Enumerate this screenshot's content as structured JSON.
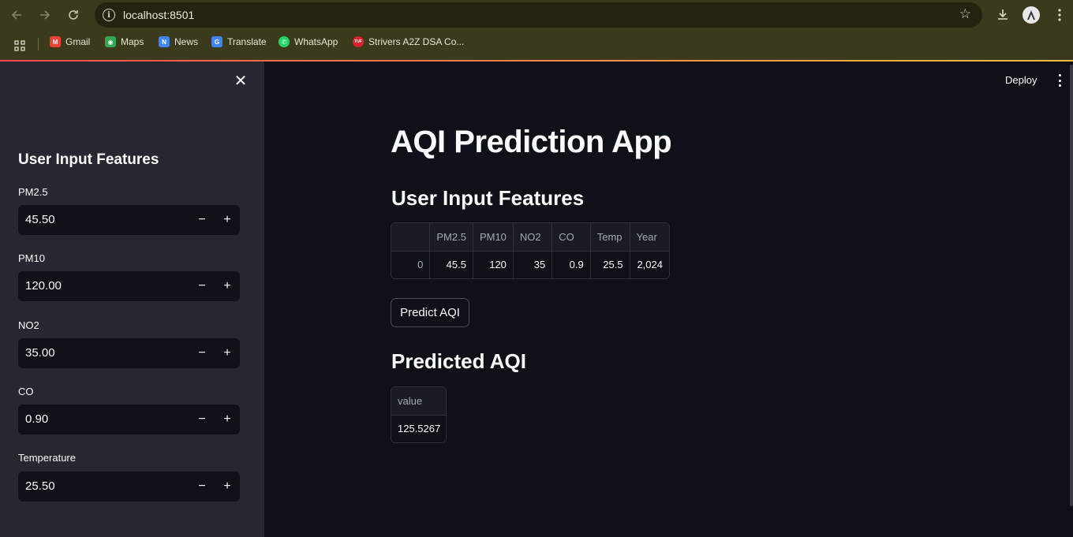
{
  "browser": {
    "url": "localhost:8501",
    "bookmarks": [
      {
        "label": "Gmail",
        "icon": "gmail-icon",
        "color": "#ea4335",
        "glyph": "M"
      },
      {
        "label": "Maps",
        "icon": "maps-icon",
        "color": "#34a853",
        "glyph": "◉"
      },
      {
        "label": "News",
        "icon": "news-icon",
        "color": "#4285f4",
        "glyph": "N"
      },
      {
        "label": "Translate",
        "icon": "translate-icon",
        "color": "#4285f4",
        "glyph": "G"
      },
      {
        "label": "WhatsApp",
        "icon": "whatsapp-icon",
        "color": "#25d366",
        "glyph": "✆"
      },
      {
        "label": "Strivers A2Z DSA Co...",
        "icon": "tuf-icon",
        "color": "#e0202c",
        "glyph": "TUF"
      }
    ]
  },
  "sidebar": {
    "title": "User Input Features",
    "fields": [
      {
        "label": "PM2.5",
        "value": "45.50"
      },
      {
        "label": "PM10",
        "value": "120.00"
      },
      {
        "label": "NO2",
        "value": "35.00"
      },
      {
        "label": "CO",
        "value": "0.90"
      },
      {
        "label": "Temperature",
        "value": "25.50"
      }
    ],
    "minus": "−",
    "plus": "+"
  },
  "header": {
    "deploy_label": "Deploy"
  },
  "main": {
    "title": "AQI Prediction App",
    "features_heading": "User Input Features",
    "features_table": {
      "columns": [
        "",
        "PM2.5",
        "PM10",
        "NO2",
        "CO",
        "Temp",
        "Year"
      ],
      "rows": [
        [
          "0",
          "45.5",
          "120",
          "35",
          "0.9",
          "25.5",
          "2,024"
        ]
      ]
    },
    "predict_button": "Predict AQI",
    "predicted_heading": "Predicted AQI",
    "predicted_table": {
      "columns": [
        "value"
      ],
      "rows": [
        [
          "125.5267"
        ]
      ]
    }
  },
  "colors": {
    "app_bg": "#0e1117",
    "sidebar_bg": "#262730",
    "accent_start": "#ff4b4b",
    "accent_end": "#ffbd45"
  }
}
